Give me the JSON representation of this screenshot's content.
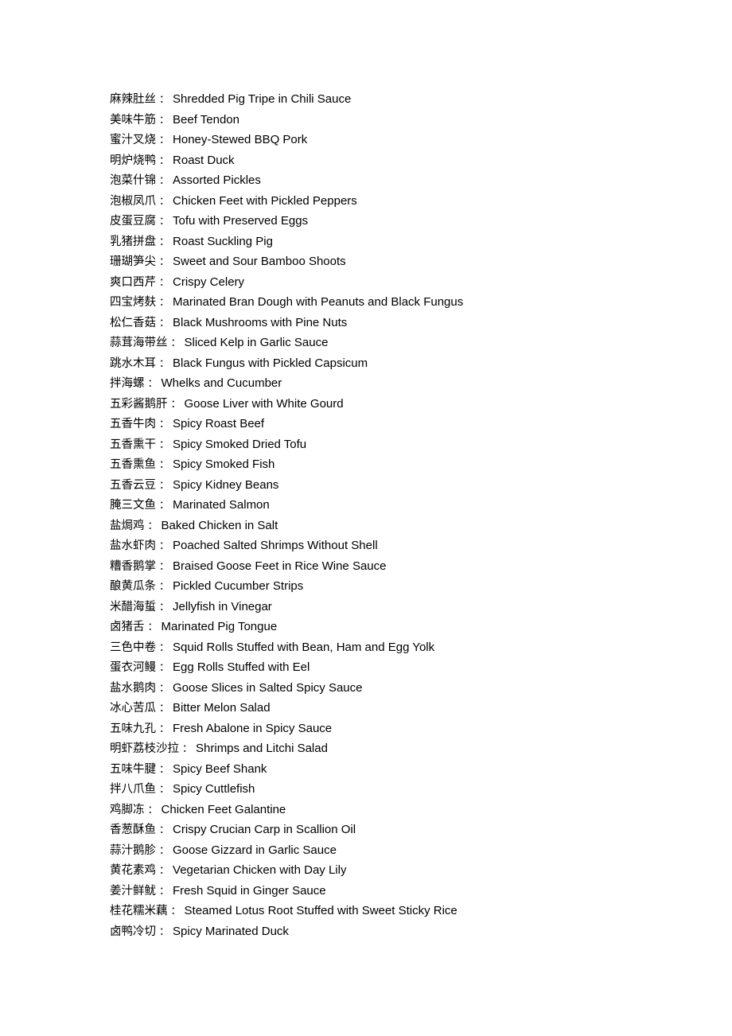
{
  "document": {
    "kind": "bilingual-menu-list",
    "separator": "：",
    "text_color": "#000000",
    "background_color": "#ffffff",
    "entries": [
      {
        "cn": "麻辣肚丝",
        "en": "Shredded Pig Tripe in Chili Sauce"
      },
      {
        "cn": "美味牛筋",
        "en": "Beef Tendon"
      },
      {
        "cn": "蜜汁叉烧",
        "en": "Honey-Stewed BBQ Pork"
      },
      {
        "cn": "明炉烧鸭",
        "en": "Roast Duck"
      },
      {
        "cn": "泡菜什锦",
        "en": "Assorted Pickles"
      },
      {
        "cn": "泡椒凤爪",
        "en": "Chicken Feet with Pickled Peppers"
      },
      {
        "cn": "皮蛋豆腐",
        "en": "Tofu with Preserved Eggs"
      },
      {
        "cn": "乳猪拼盘",
        "en": "Roast Suckling Pig"
      },
      {
        "cn": "珊瑚笋尖",
        "en": "Sweet and Sour Bamboo Shoots"
      },
      {
        "cn": "爽口西芹",
        "en": "Crispy Celery"
      },
      {
        "cn": "四宝烤麸",
        "en": "Marinated Bran Dough with Peanuts and Black Fungus"
      },
      {
        "cn": "松仁香菇",
        "en": "Black Mushrooms with Pine Nuts"
      },
      {
        "cn": "蒜茸海带丝",
        "en": "Sliced Kelp in Garlic Sauce"
      },
      {
        "cn": "跳水木耳",
        "en": "Black Fungus with Pickled Capsicum"
      },
      {
        "cn": "拌海螺",
        "en": "Whelks and Cucumber"
      },
      {
        "cn": "五彩酱鹅肝",
        "en": "Goose Liver with White Gourd"
      },
      {
        "cn": "五香牛肉",
        "en": "Spicy Roast Beef"
      },
      {
        "cn": "五香熏干",
        "en": "Spicy Smoked Dried Tofu"
      },
      {
        "cn": "五香熏鱼",
        "en": "Spicy Smoked Fish"
      },
      {
        "cn": "五香云豆",
        "en": "Spicy Kidney Beans"
      },
      {
        "cn": "腌三文鱼",
        "en": "Marinated Salmon"
      },
      {
        "cn": "盐焗鸡",
        "en": "Baked Chicken in Salt"
      },
      {
        "cn": "盐水虾肉",
        "en": "Poached Salted Shrimps Without Shell"
      },
      {
        "cn": "糟香鹅掌",
        "en": "Braised Goose Feet in Rice Wine Sauce"
      },
      {
        "cn": "酿黄瓜条",
        "en": "Pickled Cucumber Strips"
      },
      {
        "cn": "米醋海蜇",
        "en": "Jellyfish in Vinegar"
      },
      {
        "cn": "卤猪舌",
        "en": "Marinated Pig Tongue"
      },
      {
        "cn": "三色中卷",
        "en": "Squid Rolls Stuffed with Bean, Ham and Egg Yolk"
      },
      {
        "cn": "蛋衣河鳗",
        "en": "Egg Rolls Stuffed with Eel"
      },
      {
        "cn": "盐水鹅肉",
        "en": "Goose Slices in Salted Spicy Sauce"
      },
      {
        "cn": "冰心苦瓜",
        "en": "Bitter Melon Salad"
      },
      {
        "cn": "五味九孔",
        "en": "Fresh Abalone in Spicy Sauce"
      },
      {
        "cn": "明虾荔枝沙拉",
        "en": "Shrimps and Litchi Salad"
      },
      {
        "cn": "五味牛腱",
        "en": "Spicy Beef Shank"
      },
      {
        "cn": "拌八爪鱼",
        "en": "Spicy Cuttlefish"
      },
      {
        "cn": "鸡脚冻",
        "en": "Chicken Feet Galantine"
      },
      {
        "cn": "香葱酥鱼",
        "en": "Crispy Crucian Carp in Scallion Oil"
      },
      {
        "cn": "蒜汁鹅胗",
        "en": "Goose Gizzard in Garlic Sauce"
      },
      {
        "cn": "黄花素鸡",
        "en": "Vegetarian Chicken with Day Lily"
      },
      {
        "cn": "姜汁鲜鱿",
        "en": "Fresh Squid in Ginger Sauce"
      },
      {
        "cn": "桂花糯米藕",
        "en": "Steamed Lotus Root Stuffed with Sweet Sticky Rice"
      },
      {
        "cn": "卤鸭冷切",
        "en": "Spicy Marinated Duck"
      }
    ]
  }
}
